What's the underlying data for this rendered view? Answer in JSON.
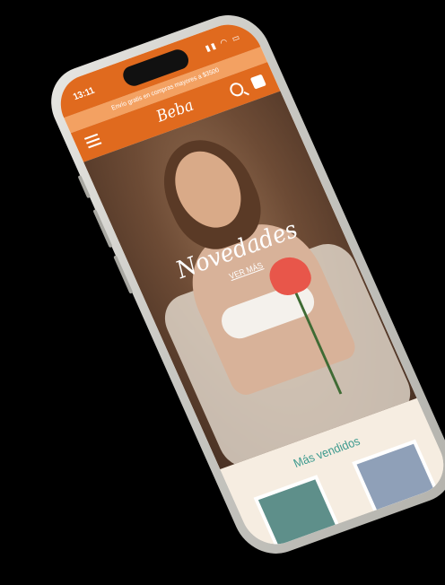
{
  "status": {
    "time": "13:11"
  },
  "promo": {
    "text": "Envío gratis en compras mayores a $3500"
  },
  "header": {
    "brand": "Beba"
  },
  "hero": {
    "title": "Novedades",
    "link": "VER MÁS"
  },
  "bestsellers": {
    "title": "Más vendidos"
  },
  "colors": {
    "primary": "#e06a1e",
    "accent": "#3c9a8e",
    "background": "#f6ede1"
  }
}
